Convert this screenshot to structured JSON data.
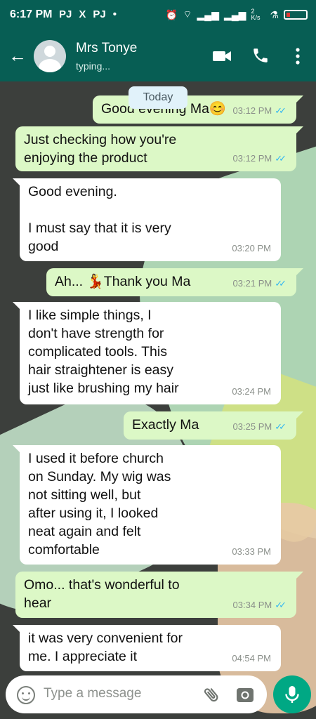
{
  "status_bar": {
    "time": "6:17 PM",
    "notification_icons": [
      "PJ",
      "X",
      "PJ",
      "•"
    ],
    "net_speed": "2 K/s",
    "battery_color": "#e53935"
  },
  "header": {
    "contact_name": "Mrs Tonye",
    "contact_status": "typing...",
    "icons": [
      "back-arrow-icon",
      "avatar",
      "video-call-icon",
      "phone-icon",
      "more-menu-icon"
    ]
  },
  "date_chip": "Today",
  "messages": [
    {
      "dir": "out",
      "text": "Good evening Ma😊",
      "time": "03:12 PM",
      "read": true
    },
    {
      "dir": "out",
      "text": "Just checking how you're\nenjoying the product",
      "time": "03:12 PM",
      "read": true
    },
    {
      "dir": "in",
      "text": "Good evening.\n\nI must say that it is very\ngood",
      "time": "03:20 PM"
    },
    {
      "dir": "out",
      "text": "Ah... 💃Thank you Ma",
      "time": "03:21 PM",
      "read": true
    },
    {
      "dir": "in",
      "text": "I like simple things, I\ndon't have strength for\ncomplicated tools. This\nhair straightener is easy\njust like brushing my hair",
      "time": "03:24 PM"
    },
    {
      "dir": "out",
      "text": "Exactly Ma",
      "time": "03:25 PM",
      "read": true
    },
    {
      "dir": "in",
      "text": "I used it before church\non Sunday. My wig was\nnot sitting well, but\nafter using it, I looked\nneat again and felt\ncomfortable",
      "time": "03:33 PM"
    },
    {
      "dir": "out",
      "text": "Omo... that's wonderful to\nhear",
      "time": "03:34 PM",
      "read": true
    },
    {
      "dir": "in",
      "text": "it was very convenient for\nme. I appreciate it",
      "time": "04:54 PM"
    }
  ],
  "input": {
    "placeholder": "Type a message"
  },
  "colors": {
    "header": "#075e54",
    "outgoing_bubble": "#dcf8c6",
    "incoming_bubble": "#ffffff",
    "read_ticks": "#34b7f1",
    "mic_button": "#00a884"
  }
}
